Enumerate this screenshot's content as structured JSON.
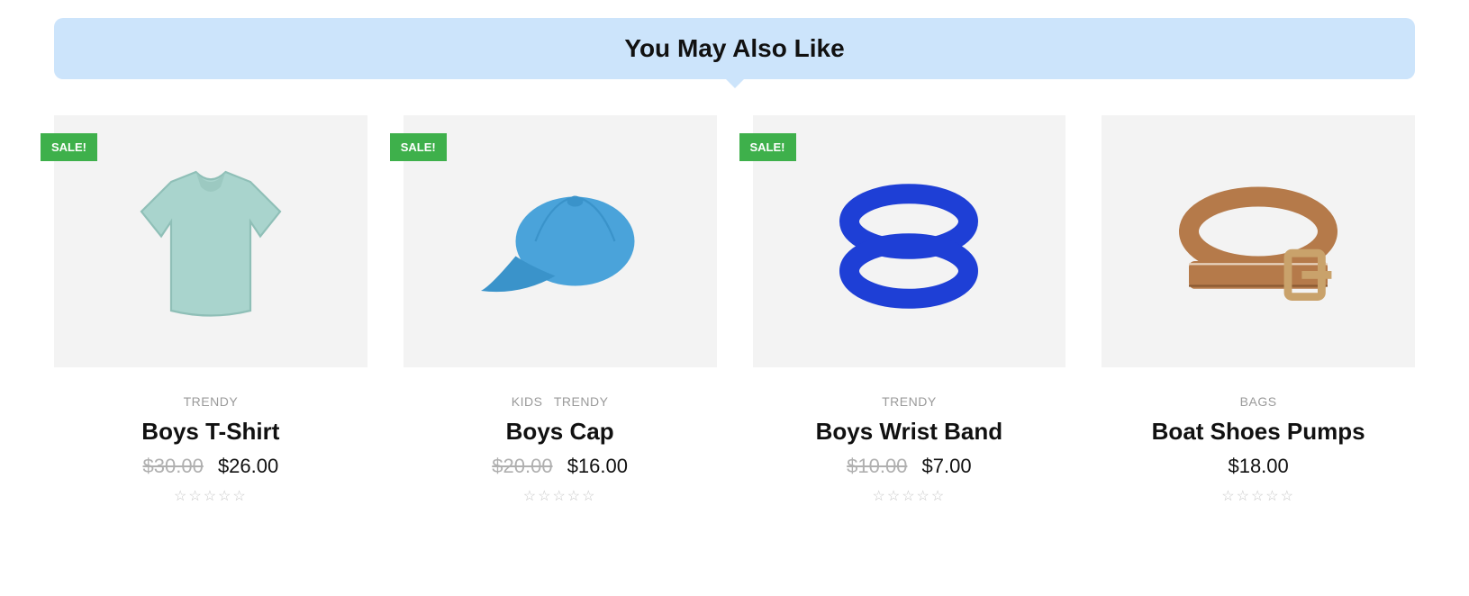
{
  "section_title": "You May Also Like",
  "sale_label": "SALE!",
  "currency": "$",
  "products": [
    {
      "categories": [
        "TRENDY"
      ],
      "title": "Boys T-Shirt",
      "old_price": "$30.00",
      "new_price": "$26.00",
      "on_sale": true,
      "rating": 0,
      "icon": "tshirt"
    },
    {
      "categories": [
        "KIDS",
        "TRENDY"
      ],
      "title": "Boys Cap",
      "old_price": "$20.00",
      "new_price": "$16.00",
      "on_sale": true,
      "rating": 0,
      "icon": "cap"
    },
    {
      "categories": [
        "TRENDY"
      ],
      "title": "Boys Wrist Band",
      "old_price": "$10.00",
      "new_price": "$7.00",
      "on_sale": true,
      "rating": 0,
      "icon": "wristband"
    },
    {
      "categories": [
        "BAGS"
      ],
      "title": "Boat Shoes Pumps",
      "old_price": "",
      "new_price": "$18.00",
      "on_sale": false,
      "rating": 0,
      "icon": "belt"
    }
  ]
}
